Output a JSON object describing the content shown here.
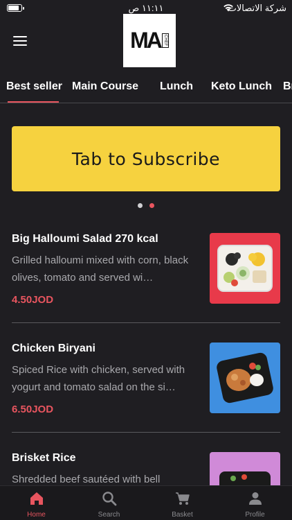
{
  "status_bar": {
    "time": "١١:١١ ص",
    "carrier": "شركة الاتصالات",
    "battery_level": 0.85
  },
  "header": {
    "logo_main": "MA",
    "logo_sub": "CHEF"
  },
  "tabs": [
    {
      "label": "Best seller",
      "active": true
    },
    {
      "label": "Main Course",
      "active": false
    },
    {
      "label": "Lunch",
      "active": false
    },
    {
      "label": "Keto Lunch",
      "active": false
    },
    {
      "label": "Br",
      "active": false
    }
  ],
  "banner": {
    "label": "Tab to Subscribe",
    "color": "#f6d23f"
  },
  "carousel": {
    "count": 2,
    "active_index": 1
  },
  "items": [
    {
      "title": "Big Halloumi Salad 270 kcal",
      "description": "Grilled halloumi mixed with corn, black olives, tomato and served wi…",
      "price": "4.50JOD",
      "thumb_bg": "#e83a4a"
    },
    {
      "title": "Chicken Biryani",
      "description": "Spiced Rice with chicken, served with yogurt and tomato salad on the si…",
      "price": "6.50JOD",
      "thumb_bg": "#3f8fe0"
    },
    {
      "title": "Brisket Rice",
      "description": "Shredded beef sautéed with bell",
      "price": "",
      "thumb_bg": "#d08ad8"
    }
  ],
  "bottom_nav": [
    {
      "label": "Home",
      "icon": "home-icon",
      "active": true
    },
    {
      "label": "Search",
      "icon": "search-icon",
      "active": false
    },
    {
      "label": "Basket",
      "icon": "cart-icon",
      "active": false
    },
    {
      "label": "Profile",
      "icon": "profile-icon",
      "active": false
    }
  ],
  "colors": {
    "background": "#1f1e22",
    "accent": "#e8555f",
    "banner": "#f6d23f",
    "nav_inactive": "#8a8a8e"
  }
}
